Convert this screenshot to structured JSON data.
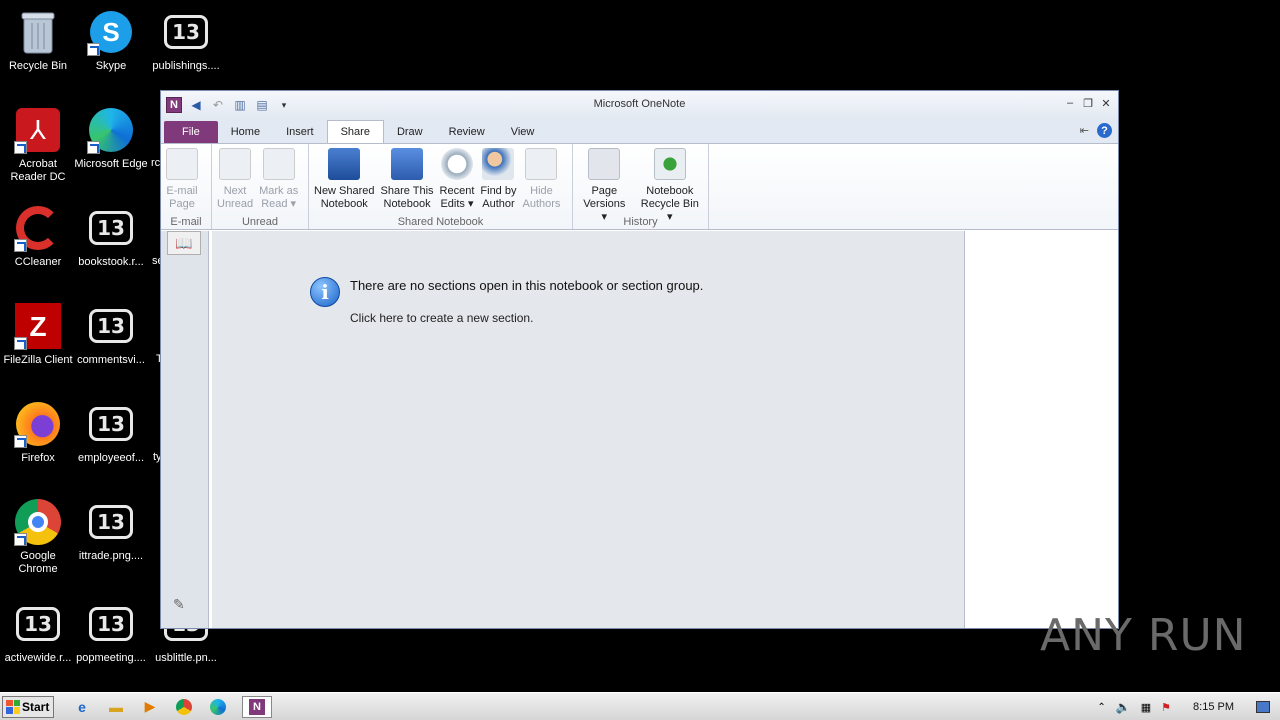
{
  "desktop": {
    "icons": [
      {
        "label": "Recycle Bin"
      },
      {
        "label": "Skype"
      },
      {
        "label": "publishings...."
      },
      {
        "label": "Acrobat Reader DC"
      },
      {
        "label": "Microsoft Edge"
      },
      {
        "label": "CCleaner"
      },
      {
        "label": "bookstook.r..."
      },
      {
        "label": "FileZilla Client"
      },
      {
        "label": "commentsvi..."
      },
      {
        "label": "Firefox"
      },
      {
        "label": "employeeof..."
      },
      {
        "label": "Google Chrome"
      },
      {
        "label": "ittrade.png...."
      },
      {
        "label": "activewide.r..."
      },
      {
        "label": "popmeeting...."
      },
      {
        "label": "usblittle.pn..."
      }
    ],
    "partial_labels": {
      "rc": "rc",
      "se": "se",
      "t1": "T",
      "ty": "ty"
    }
  },
  "window": {
    "title": "Microsoft OneNote",
    "app_letter": "N"
  },
  "ribbon": {
    "tabs": [
      "File",
      "Home",
      "Insert",
      "Share",
      "Draw",
      "Review",
      "View"
    ],
    "active_tab": "Share",
    "groups": {
      "email": {
        "label": "E-mail",
        "buttons": [
          {
            "line1": "E-mail",
            "line2": "Page"
          }
        ]
      },
      "unread": {
        "label": "Unread",
        "buttons": [
          {
            "line1": "Next",
            "line2": "Unread"
          },
          {
            "line1": "Mark as",
            "line2": "Read ▾"
          }
        ]
      },
      "shared": {
        "label": "Shared Notebook",
        "buttons": [
          {
            "line1": "New Shared",
            "line2": "Notebook"
          },
          {
            "line1": "Share This",
            "line2": "Notebook"
          },
          {
            "line1": "Recent",
            "line2": "Edits ▾"
          },
          {
            "line1": "Find by",
            "line2": "Author"
          },
          {
            "line1": "Hide",
            "line2": "Authors"
          }
        ]
      },
      "history": {
        "label": "History",
        "buttons": [
          {
            "line1": "Page",
            "line2": "Versions ▾"
          },
          {
            "line1": "Notebook",
            "line2": "Recycle Bin ▾"
          }
        ]
      }
    }
  },
  "content": {
    "message": "There are no sections open in this notebook or section group.",
    "link": "Click here to create a new section."
  },
  "taskbar": {
    "start_label": "Start",
    "clock": "8:15 PM"
  },
  "watermark": "ANY RUN"
}
